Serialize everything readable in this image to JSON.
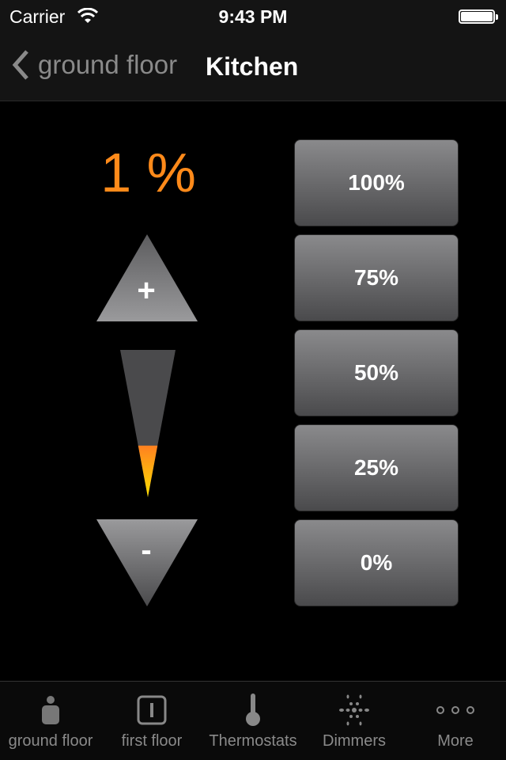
{
  "status_bar": {
    "carrier": "Carrier",
    "time": "9:43 PM"
  },
  "nav": {
    "back_label": "ground floor",
    "title": "Kitchen"
  },
  "dimmer": {
    "level_text": "1 %",
    "level_percent": 1,
    "accent_color": "#ff8a1a"
  },
  "presets": [
    {
      "label": "100%"
    },
    {
      "label": "75%"
    },
    {
      "label": "50%"
    },
    {
      "label": "25%"
    },
    {
      "label": "0%"
    }
  ],
  "controls": {
    "increase_label": "+",
    "decrease_label": "-"
  },
  "tabs": [
    {
      "label": "ground floor",
      "icon": "person-icon"
    },
    {
      "label": "first floor",
      "icon": "switch-icon"
    },
    {
      "label": "Thermostats",
      "icon": "thermometer-icon"
    },
    {
      "label": "Dimmers",
      "icon": "dimmer-icon"
    },
    {
      "label": "More",
      "icon": "more-icon"
    }
  ]
}
